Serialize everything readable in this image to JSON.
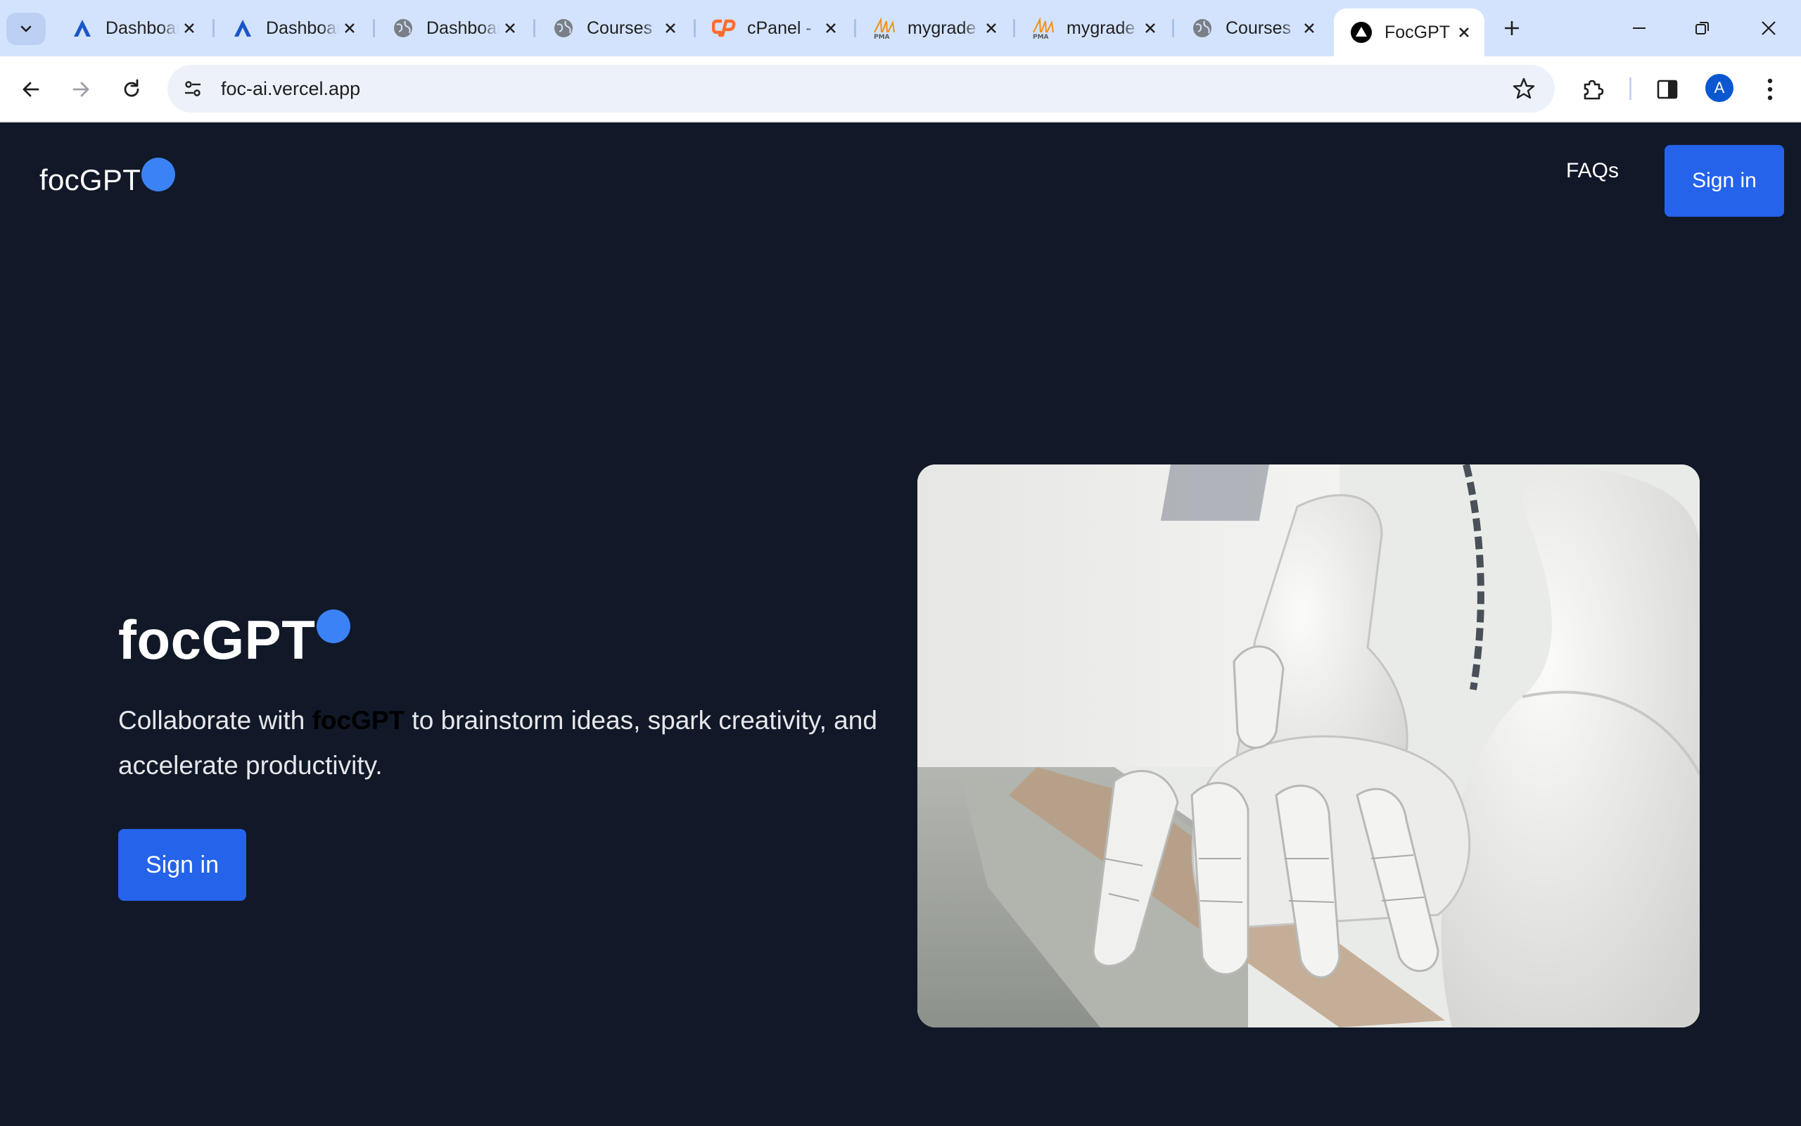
{
  "browser": {
    "tabs": [
      {
        "title": "Dashboard",
        "icon": "arc-logo-icon"
      },
      {
        "title": "Dashboard",
        "icon": "arc-logo-icon"
      },
      {
        "title": "Dashboard",
        "icon": "globe-icon"
      },
      {
        "title": "Courses",
        "icon": "globe-icon"
      },
      {
        "title": "cPanel -",
        "icon": "cpanel-icon"
      },
      {
        "title": "mygrade",
        "icon": "pma-icon"
      },
      {
        "title": "mygrade",
        "icon": "pma-icon"
      },
      {
        "title": "Courses",
        "icon": "globe-icon"
      },
      {
        "title": "FocGPT",
        "icon": "vercel-icon",
        "active": true
      }
    ],
    "url": "foc-ai.vercel.app",
    "profile_initial": "A"
  },
  "header": {
    "brand": "focGPT",
    "faqs_label": "FAQs",
    "signin_label": "Sign in"
  },
  "hero": {
    "title": "focGPT",
    "text_before": "Collaborate with ",
    "text_highlight": "focGPT",
    "text_after": " to brainstorm ideas, spark creativity, and accelerate productivity.",
    "signin_label": "Sign in",
    "image_subject": "robot-hand-photo"
  },
  "colors": {
    "page_bg": "#111827",
    "accent": "#2563eb",
    "dot": "#3b82f6",
    "tabbar_bg": "#d3e3fd"
  }
}
